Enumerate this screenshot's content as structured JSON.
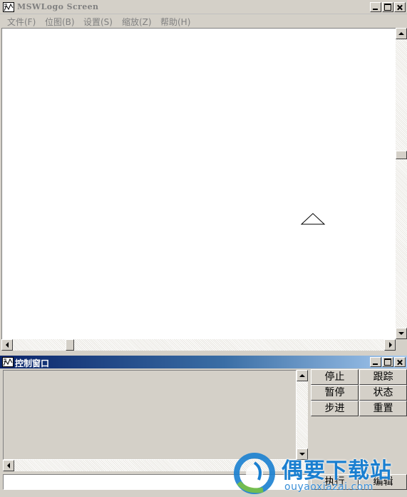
{
  "main_window": {
    "title": "MSWLogo Screen",
    "menu": [
      {
        "label": "文件(F)"
      },
      {
        "label": "位图(B)"
      },
      {
        "label": "设置(S)"
      },
      {
        "label": "缩放(Z)"
      },
      {
        "label": "帮助(H)"
      }
    ]
  },
  "control_window": {
    "title": "控制窗口",
    "buttons": {
      "halt": "停止",
      "trace": "跟踪",
      "pause": "暂停",
      "status": "状态",
      "step": "步进",
      "reset": "重置",
      "execute": "执行",
      "edit": "编辑"
    },
    "command_input": {
      "value": "",
      "placeholder": ""
    }
  },
  "watermark": {
    "brand": "偶要下载站",
    "url": "ouyaoxiazai.com",
    "colors": {
      "primary": "#1a7fd0",
      "accent": "#7ac143"
    }
  },
  "colors": {
    "window_face": "#d4d0c8",
    "canvas": "#ffffff",
    "active_title_start": "#0a246a",
    "active_title_end": "#a6caf0",
    "inactive_title_text": "#808080"
  }
}
